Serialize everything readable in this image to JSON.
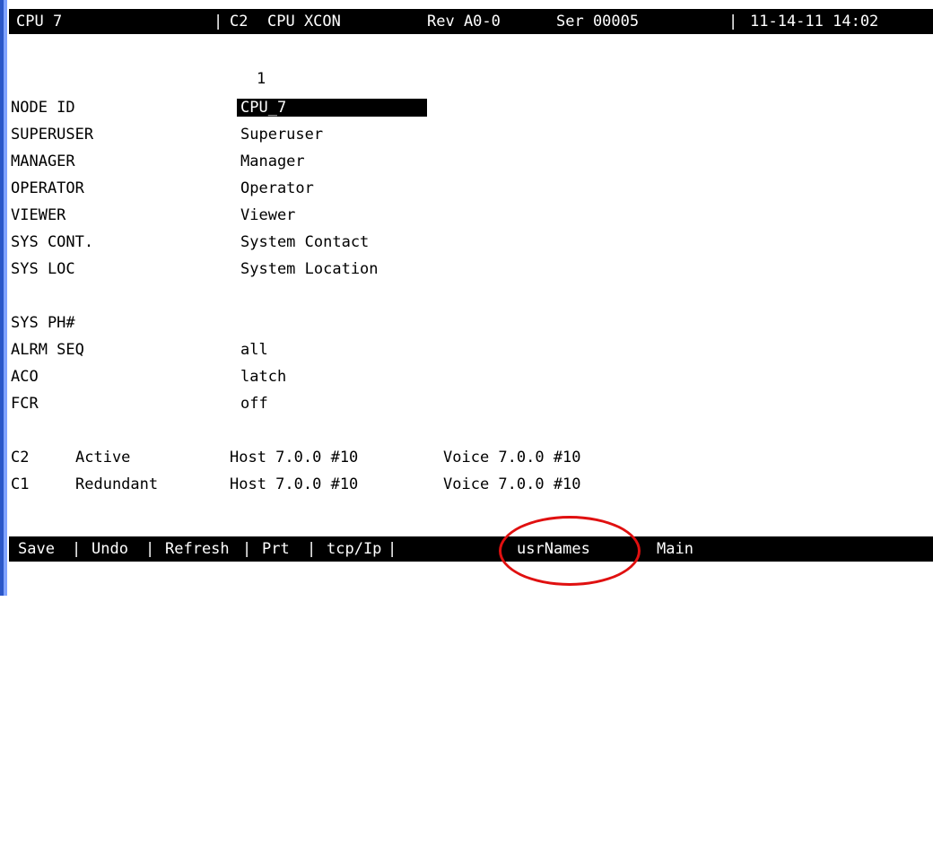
{
  "header": {
    "node": "CPU 7",
    "card": "C2",
    "card_name": "CPU XCON",
    "rev": "Rev A0-0",
    "serial": "Ser 00005",
    "datetime": "11-14-11 14:02"
  },
  "column_header": "1",
  "fields": [
    {
      "label": "NODE ID",
      "value": "CPU_7"
    },
    {
      "label": "SUPERUSER",
      "value": "Superuser"
    },
    {
      "label": "MANAGER",
      "value": "Manager"
    },
    {
      "label": "OPERATOR",
      "value": "Operator"
    },
    {
      "label": "VIEWER",
      "value": "Viewer"
    },
    {
      "label": "SYS CONT.",
      "value": "System Contact"
    },
    {
      "label": "SYS LOC",
      "value": "System Location"
    },
    {
      "label": "SYS PH#",
      "value": ""
    },
    {
      "label": "ALRM SEQ",
      "value": "all"
    },
    {
      "label": "ACO",
      "value": "latch"
    },
    {
      "label": "FCR",
      "value": "off"
    }
  ],
  "cards": [
    {
      "slot": "C2",
      "state": "Active",
      "host": "Host 7.0.0 #10",
      "voice": "Voice 7.0.0 #10"
    },
    {
      "slot": "C1",
      "state": "Redundant",
      "host": "Host 7.0.0 #10",
      "voice": "Voice 7.0.0 #10"
    }
  ],
  "menu": {
    "save": "Save",
    "undo": "Undo",
    "refresh": "Refresh",
    "prt": "Prt",
    "tcpip": "tcp/Ip",
    "usrnames": "usrNames",
    "main": "Main"
  },
  "colors": {
    "bar_bg": "#000000",
    "bar_fg": "#ffffff",
    "annotation": "#e01010",
    "window_border": "#2b57c8"
  }
}
